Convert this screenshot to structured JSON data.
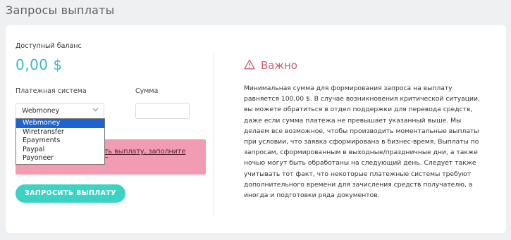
{
  "page": {
    "title": "Запросы выплаты"
  },
  "balance": {
    "label": "Доступный баланс",
    "value": "0,00 $"
  },
  "form": {
    "payment_system_label": "Платежная система",
    "sum_label": "Сумма",
    "selected_system": "Webmoney",
    "sum_value": "",
    "options": [
      "Webmoney",
      "Wiretransfer",
      "Epayments",
      "Paypal",
      "Payoneer"
    ],
    "submit_label": "ЗАПРОСИТЬ ВЫПЛАТУ"
  },
  "alert": {
    "visible_text": "ть выплату, заполните"
  },
  "important": {
    "title": "Важно",
    "text": "Минимальная сумма для формирования запроса на выплату равняется 100,00 $. В случае возникновения критической ситуации, вы можете обратиться в отдел поддержки для перевода средств, даже если сумма платежа не превышает указанный выше. Мы делаем все возможное, чтобы производить моментальные выплаты при условии, что заявка сформирована в бизнес-время. Выплаты по запросам, сформированным в выходные/праздничные дни, а также ночью могут быть обработаны на следующий день. Следует также учитывать тот факт, что некоторые платежные системы требуют дополнительного времени для зачисления средств получателю, а иногда и подготовки ряда документов."
  },
  "colors": {
    "accent": "#3db5c9",
    "button": "#3dd3c4",
    "alert_bg": "#f19cb2",
    "warning": "#d05b6e",
    "selected_option": "#1e64d0"
  },
  "icons": {
    "warning": "warning-triangle-icon",
    "chevron": "chevron-down-icon"
  }
}
